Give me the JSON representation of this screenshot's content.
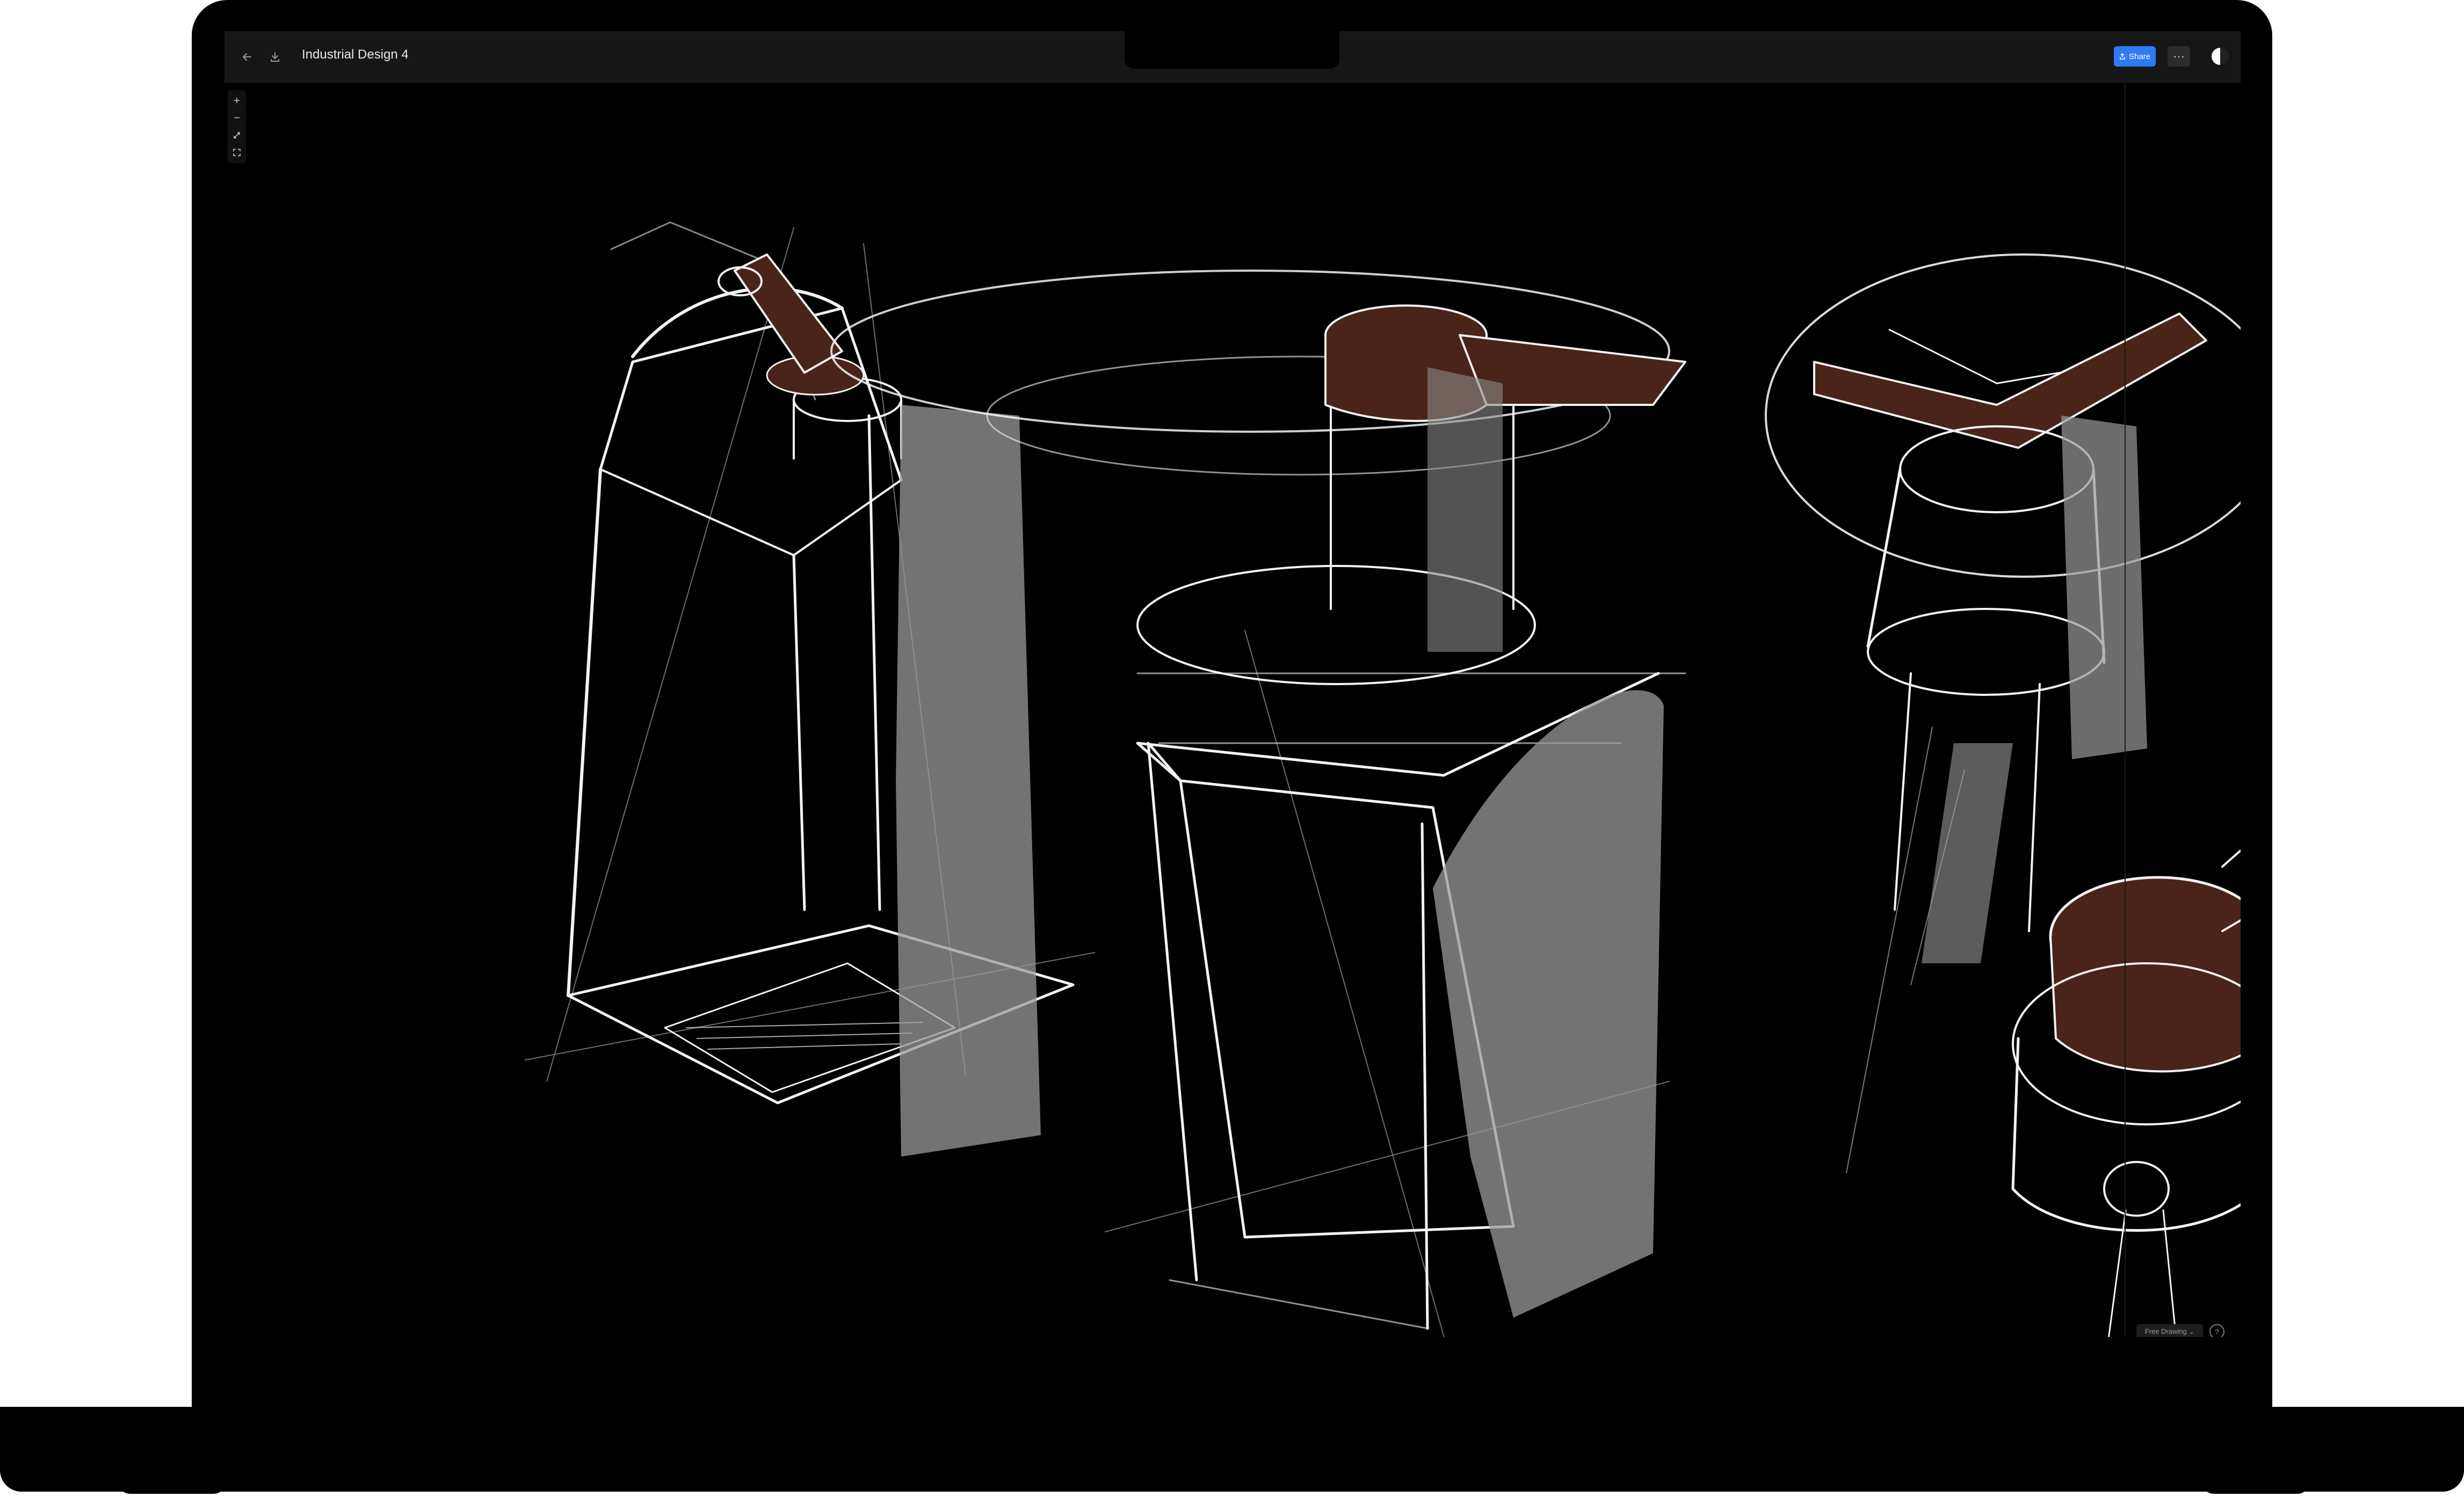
{
  "document": {
    "title": "Industrial Design 4"
  },
  "toolbar": {
    "back_icon": "arrow-left-icon",
    "download_icon": "download-icon",
    "share_label": "Share",
    "share_icon": "share-icon",
    "more_label": "···"
  },
  "zoom_controls": {
    "zoom_in": "+",
    "zoom_out": "−",
    "fit_icon": "expand-arrows-icon",
    "fullscreen_icon": "fullscreen-icon"
  },
  "footer": {
    "mode_label": "Free Drawing ⌄",
    "help_label": "?"
  },
  "colors": {
    "accent": "#2f7bf5",
    "sketch_line": "#f2f2f2",
    "sketch_fill_brown": "#4a2419",
    "sketch_fill_gray": "#9a9a9a"
  }
}
